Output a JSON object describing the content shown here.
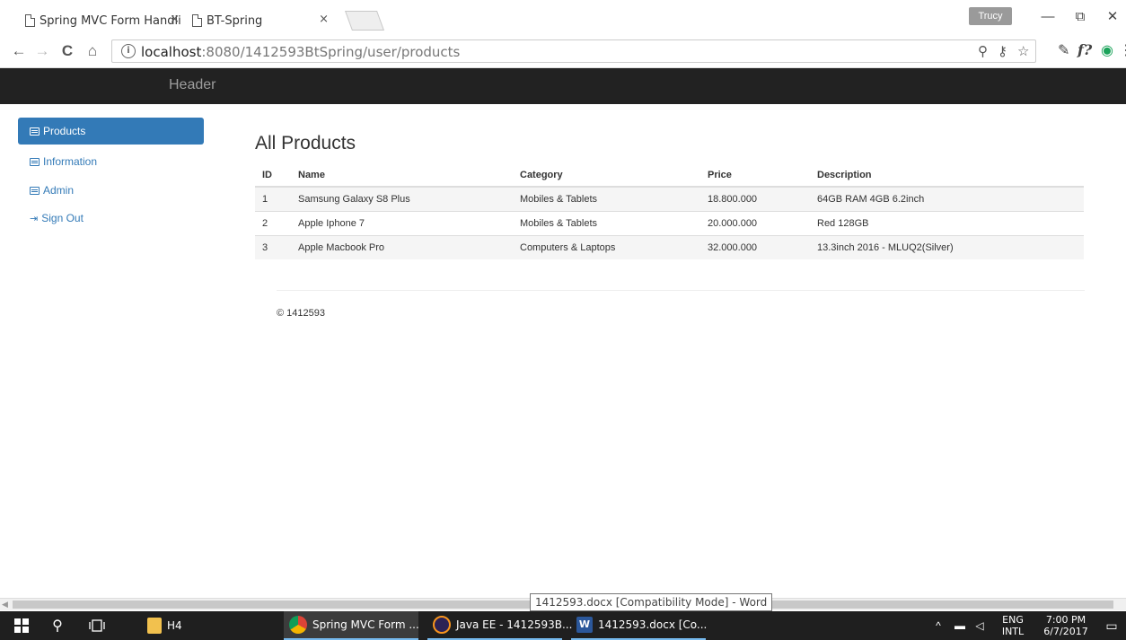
{
  "browser": {
    "tabs": [
      {
        "label": "Spring MVC Form Handli",
        "close": "×"
      },
      {
        "label": "BT-Spring",
        "close": "×"
      }
    ],
    "profile": "Trucy",
    "window": {
      "minimize": "—",
      "restore": "⧉",
      "close": "✕"
    },
    "nav": {
      "back": "←",
      "forward": "→",
      "reload": "C",
      "home": "⌂"
    },
    "url": {
      "info": "i",
      "host": "localhost",
      "path": ":8080/1412593BtSpring/user/products"
    },
    "icons": [
      "zoom-icon",
      "key-icon",
      "star-icon",
      "eyedropper-icon",
      "fx-icon",
      "eye-extension-icon",
      "menu-icon"
    ]
  },
  "site": {
    "header": "Header",
    "sidebar": [
      {
        "label": "Products",
        "active": true,
        "icon": "list-icon"
      },
      {
        "label": "Information",
        "active": false,
        "icon": "list-icon"
      },
      {
        "label": "Admin",
        "active": false,
        "icon": "list-icon"
      },
      {
        "label": "Sign Out",
        "active": false,
        "icon": "sign-out-icon"
      }
    ],
    "page_title": "All Products",
    "table": {
      "columns": [
        "ID",
        "Name",
        "Category",
        "Price",
        "Description"
      ],
      "rows": [
        [
          "1",
          "Samsung Galaxy S8 Plus",
          "Mobiles & Tablets",
          "18.800.000",
          "64GB RAM 4GB 6.2inch"
        ],
        [
          "2",
          "Apple Iphone 7",
          "Mobiles & Tablets",
          "20.000.000",
          "Red 128GB"
        ],
        [
          "3",
          "Apple Macbook Pro",
          "Computers & Laptops",
          "32.000.000",
          "13.3inch 2016 - MLUQ2(Silver)"
        ]
      ]
    },
    "footer": "© 1412593"
  },
  "tooltip": "1412593.docx [Compatibility Mode] - Word",
  "taskbar": {
    "folder_label": "H4",
    "apps": [
      {
        "label": "Spring MVC Form ...",
        "color": "#4285f4"
      },
      {
        "label": "Java EE - 1412593B...",
        "color": "#2c2255"
      },
      {
        "label": "1412593.docx [Co...",
        "color": "#2b579a"
      }
    ],
    "word_glyph": "W",
    "lang": [
      "ENG",
      "INTL"
    ],
    "time": "7:00 PM",
    "date": "6/7/2017"
  }
}
